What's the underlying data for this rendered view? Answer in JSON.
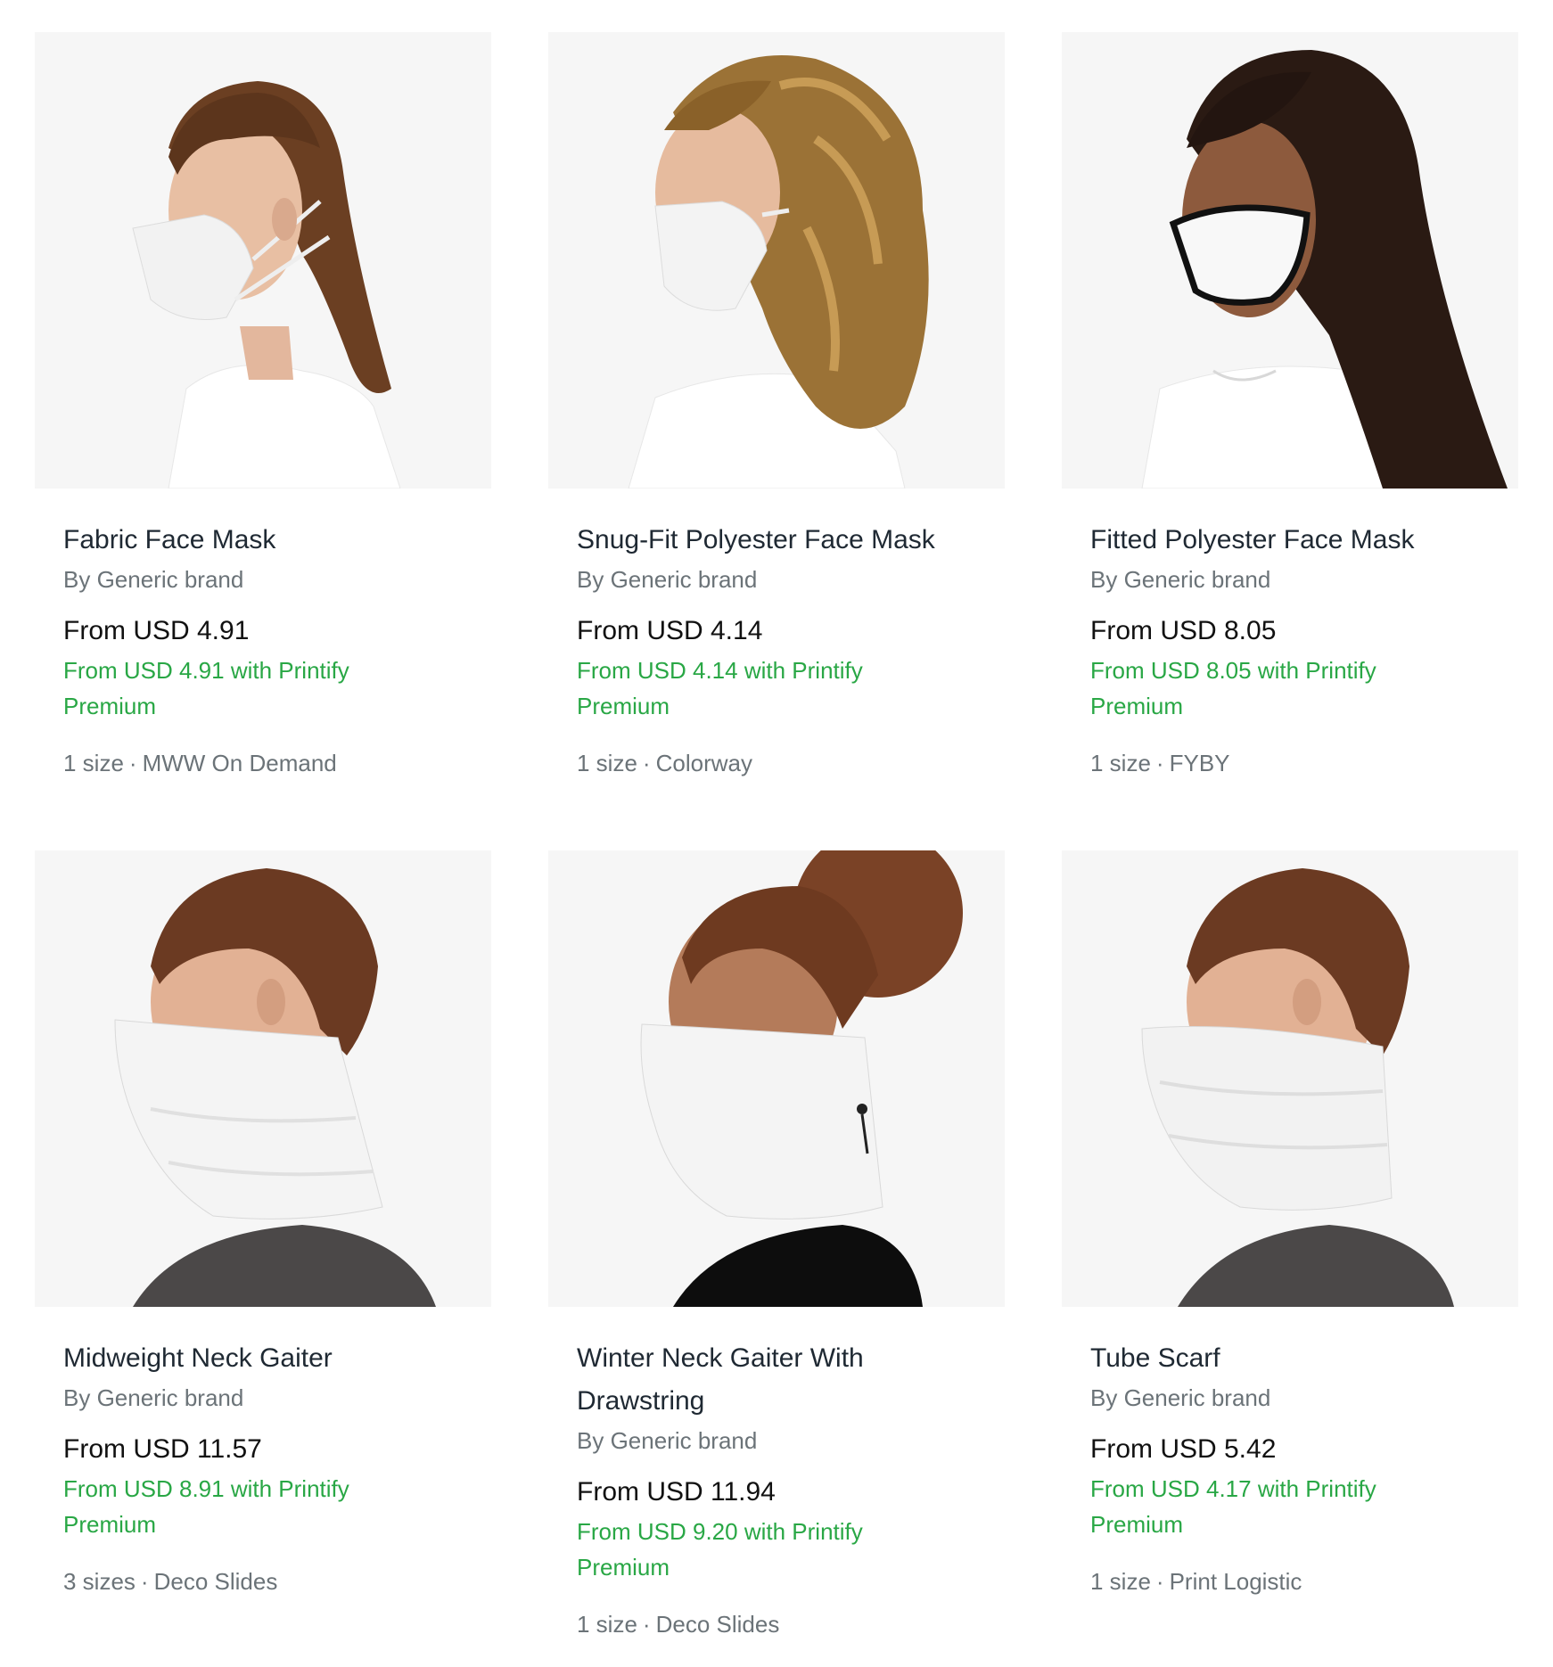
{
  "products": [
    {
      "title": "Fabric Face Mask",
      "brand": "By Generic brand",
      "price": "From USD 4.91",
      "premium": "From USD 4.91 with Printify Premium",
      "sizes": "1 size",
      "provider": "MWW On Demand",
      "image": "woman-ponytail-fabric-mask"
    },
    {
      "title": "Snug-Fit Polyester Face Mask",
      "brand": "By Generic brand",
      "price": "From USD 4.14",
      "premium": "From USD 4.14 with Printify Premium",
      "sizes": "1 size",
      "provider": "Colorway",
      "image": "woman-curly-hair-snugfit-mask"
    },
    {
      "title": "Fitted Polyester Face Mask",
      "brand": "By Generic brand",
      "price": "From USD 8.05",
      "premium": "From USD 8.05 with Printify Premium",
      "sizes": "1 size",
      "provider": "FYBY",
      "image": "woman-long-hair-fitted-mask"
    },
    {
      "title": "Midweight Neck Gaiter",
      "brand": "By Generic brand",
      "price": "From USD 11.57",
      "premium": "From USD 8.91 with Printify Premium",
      "sizes": "3 sizes",
      "provider": "Deco Slides",
      "image": "man-neck-gaiter"
    },
    {
      "title": "Winter Neck Gaiter With Drawstring",
      "brand": "By Generic brand",
      "price": "From USD 11.94",
      "premium": "From USD 9.20 with Printify Premium",
      "sizes": "1 size",
      "provider": "Deco Slides",
      "image": "woman-bun-winter-gaiter"
    },
    {
      "title": "Tube Scarf",
      "brand": "By Generic brand",
      "price": "From USD 5.42",
      "premium": "From USD 4.17 with Printify Premium",
      "sizes": "1 size",
      "provider": "Print Logistic",
      "image": "man-tube-scarf"
    }
  ],
  "separator": "·",
  "colors": {
    "price_premium": "#29a745",
    "muted": "#6b7378",
    "title": "#1f2933",
    "thumb_bg": "#f5f5f5"
  }
}
